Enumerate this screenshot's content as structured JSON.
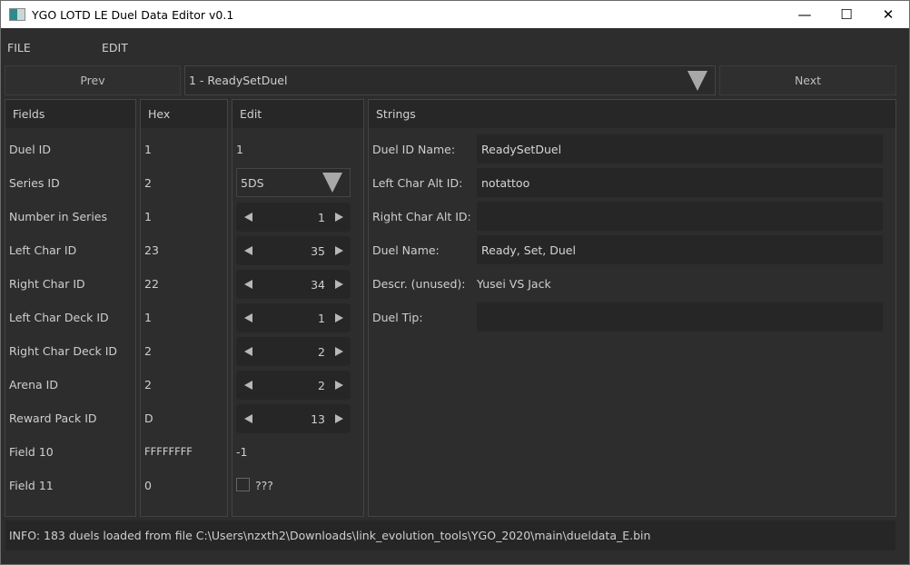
{
  "window": {
    "title": "YGO LOTD LE Duel Data Editor v0.1",
    "minimize_glyph": "—",
    "maximize_glyph": "☐",
    "close_glyph": "✕"
  },
  "menu": {
    "file": "FILE",
    "edit": "EDIT"
  },
  "nav": {
    "prev_label": "Prev",
    "next_label": "Next",
    "selected_duel": "1 - ReadySetDuel"
  },
  "fields_panel": {
    "header": "Fields",
    "labels": [
      "Duel ID",
      "Series ID",
      "Number in Series",
      "Left Char ID",
      "Right Char ID",
      "Left Char Deck ID",
      "Right Char Deck ID",
      "Arena ID",
      "Reward Pack ID",
      "Field 10",
      "Field 11"
    ]
  },
  "hex_panel": {
    "header": "Hex",
    "values": [
      "1",
      "2",
      "1",
      "23",
      "22",
      "1",
      "2",
      "2",
      "D",
      "FFFFFFFF",
      "0"
    ]
  },
  "edit_panel": {
    "header": "Edit",
    "duel_id": "1",
    "series_id": "5DS",
    "number_in_series": "1",
    "left_char_id": "35",
    "right_char_id": "34",
    "left_char_deck_id": "1",
    "right_char_deck_id": "2",
    "arena_id": "2",
    "reward_pack_id": "13",
    "field10": "-1",
    "field11_checkbox_label": "???",
    "field11_checked": false
  },
  "strings_panel": {
    "header": "Strings",
    "duel_id_name_label": "Duel ID Name:",
    "duel_id_name": "ReadySetDuel",
    "left_char_alt_label": "Left Char Alt ID:",
    "left_char_alt": "notattoo",
    "right_char_alt_label": "Right Char Alt ID:",
    "right_char_alt": "",
    "duel_name_label": "Duel Name:",
    "duel_name": "Ready, Set, Duel",
    "descr_label": "Descr. (unused):",
    "descr": "Yusei VS Jack",
    "duel_tip_label": "Duel Tip:",
    "duel_tip": ""
  },
  "status": {
    "text": "INFO: 183 duels loaded from file C:\\Users\\nzxth2\\Downloads\\link_evolution_tools\\YGO_2020\\main\\dueldata_E.bin"
  }
}
